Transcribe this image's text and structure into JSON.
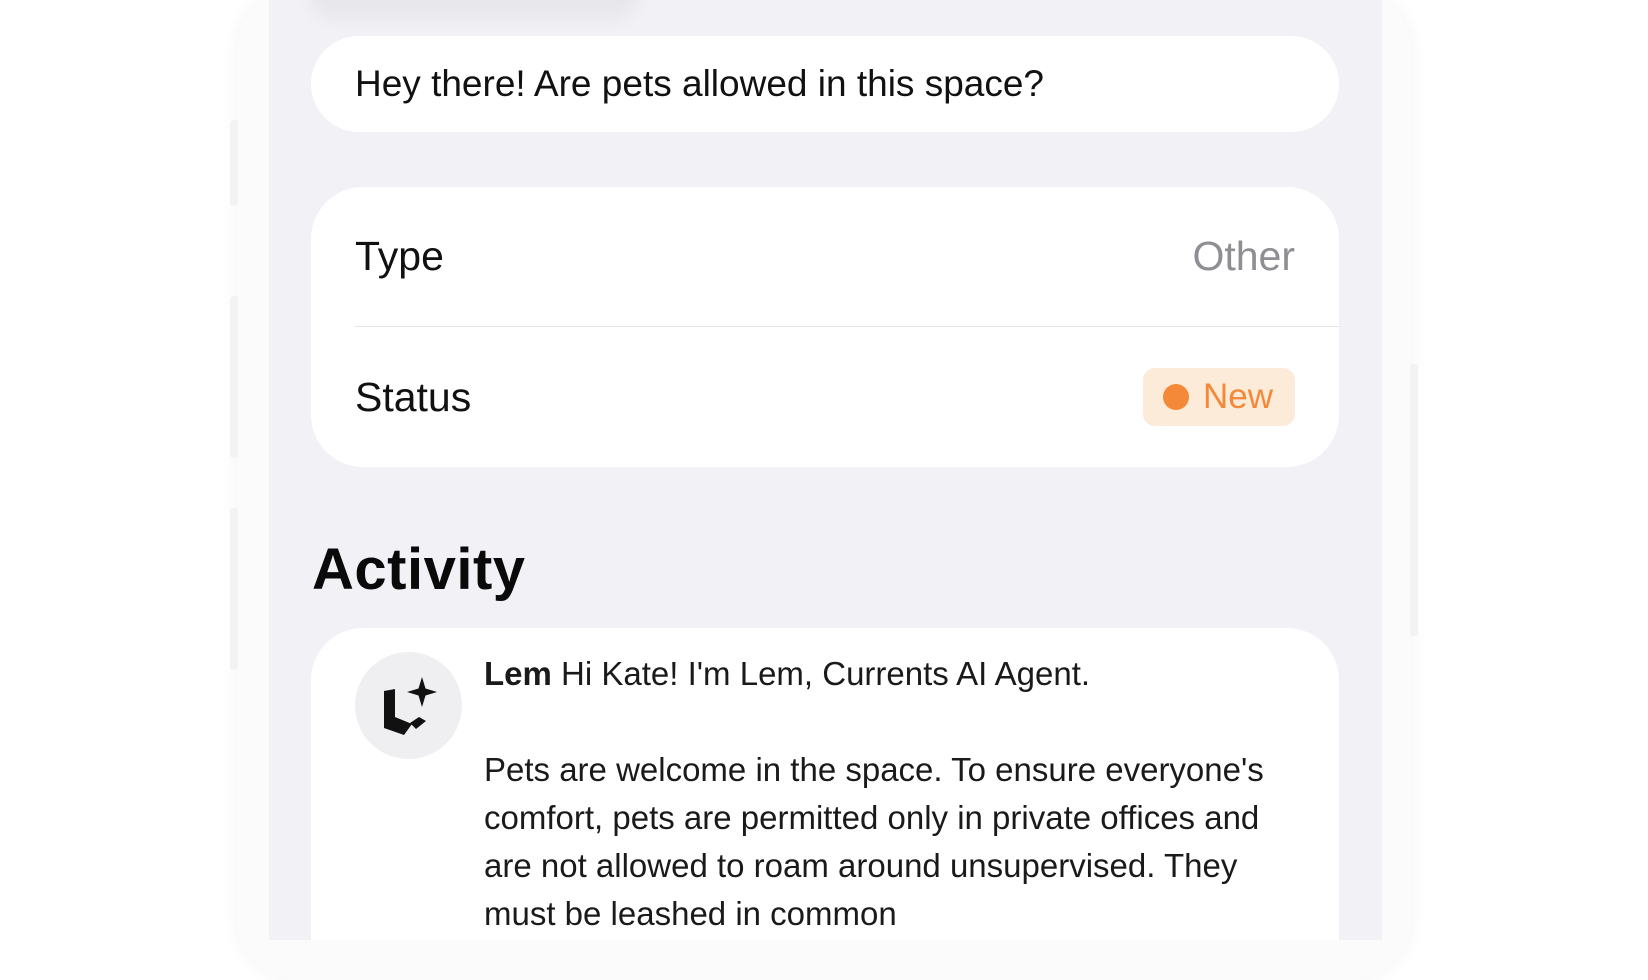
{
  "message": {
    "text": "Hey there! Are pets allowed in this space?"
  },
  "details": {
    "type_label": "Type",
    "type_value": "Other",
    "status_label": "Status",
    "status_value": "New",
    "status_color": "#f5893a",
    "status_bg": "#fdebd9"
  },
  "activity": {
    "title": "Activity",
    "entries": [
      {
        "avatar_icon": "lem-ai-logo-icon",
        "author": "Lem",
        "greeting": "Hi Kate! I'm Lem, Currents AI Agent.",
        "body": "Pets are welcome in the space. To ensure everyone's comfort, pets are permitted only in private offices and are not allowed to roam around unsupervised. They must be leashed in common"
      }
    ]
  }
}
